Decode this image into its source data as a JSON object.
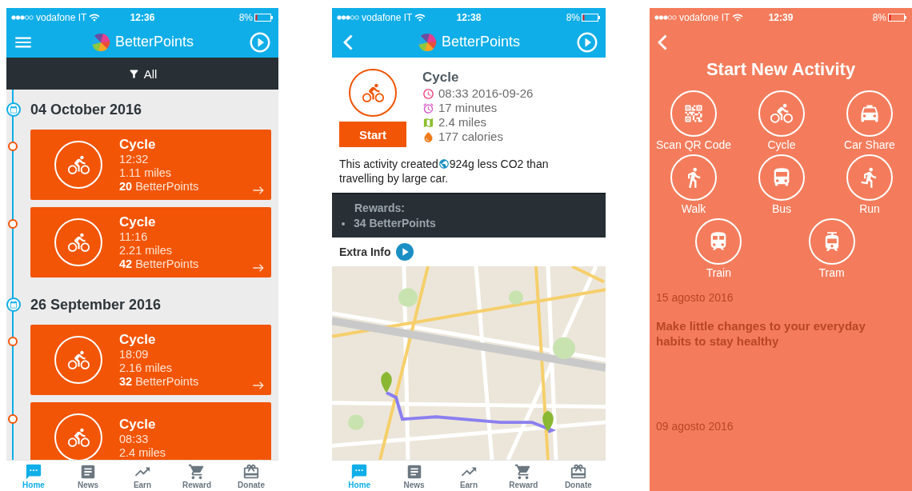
{
  "phones": [
    {
      "kind": "timeline",
      "status": {
        "carrier": "vodafone IT",
        "time": "12:36",
        "battery": "8%"
      },
      "header": {
        "title": "BetterPoints"
      },
      "filter": "All",
      "groups": [
        {
          "date": "04 October 2016",
          "activities": [
            {
              "name": "Cycle",
              "time": "12:32",
              "distance": "1.11 miles",
              "points": "**20** BetterPoints"
            },
            {
              "name": "Cycle",
              "time": "11:16",
              "distance": "2.21 miles",
              "points": "**42** BetterPoints"
            }
          ]
        },
        {
          "date": "26 September 2016",
          "activities": [
            {
              "name": "Cycle",
              "time": "18:09",
              "distance": "2.16 miles",
              "points": "**32** BetterPoints"
            },
            {
              "name": "Cycle",
              "time": "08:33",
              "distance": "2.4 miles"
            }
          ]
        }
      ],
      "tabs": [
        {
          "label": "Home",
          "selected": true
        },
        {
          "label": "News",
          "selected": false
        },
        {
          "label": "Earn",
          "selected": false
        },
        {
          "label": "Reward",
          "selected": false
        },
        {
          "label": "Donate",
          "selected": false
        }
      ]
    },
    {
      "kind": "detail",
      "status": {
        "carrier": "vodafone IT",
        "time": "12:38",
        "battery": "8%"
      },
      "header": {
        "title": "BetterPoints"
      },
      "activity": {
        "name": "Cycle",
        "details": [
          "08:33 2016-09-26",
          "17 minutes",
          "2.4 miles",
          "177 calories"
        ],
        "button": "Start"
      },
      "co2": {
        "prefix": "This activity created",
        "text": "924g less CO2 than",
        "continuation": "travelling by large car."
      },
      "rewards": {
        "title": "Rewards:",
        "items": [
          "34 BetterPoints"
        ]
      },
      "extra_info": "Extra Info",
      "tabs": [
        {
          "label": "Home",
          "selected": true
        },
        {
          "label": "News",
          "selected": false
        },
        {
          "label": "Earn",
          "selected": false
        },
        {
          "label": "Reward",
          "selected": false
        },
        {
          "label": "Donate",
          "selected": false
        }
      ]
    },
    {
      "kind": "picker",
      "status": {
        "carrier": "vodafone IT",
        "time": "12:39",
        "battery": "8%"
      },
      "title": "Start New Activity",
      "options": [
        "Scan QR Code",
        "Cycle",
        "Car Share",
        "Walk",
        "Bus",
        "Run",
        "Train",
        "Tram"
      ],
      "background_texts": [
        {
          "kind": "date",
          "text": "15 agosto 2016"
        },
        {
          "kind": "headline",
          "text": "Make little changes to your everyday habits to stay healthy"
        },
        {
          "kind": "date",
          "text": "09 agosto 2016"
        }
      ]
    }
  ]
}
